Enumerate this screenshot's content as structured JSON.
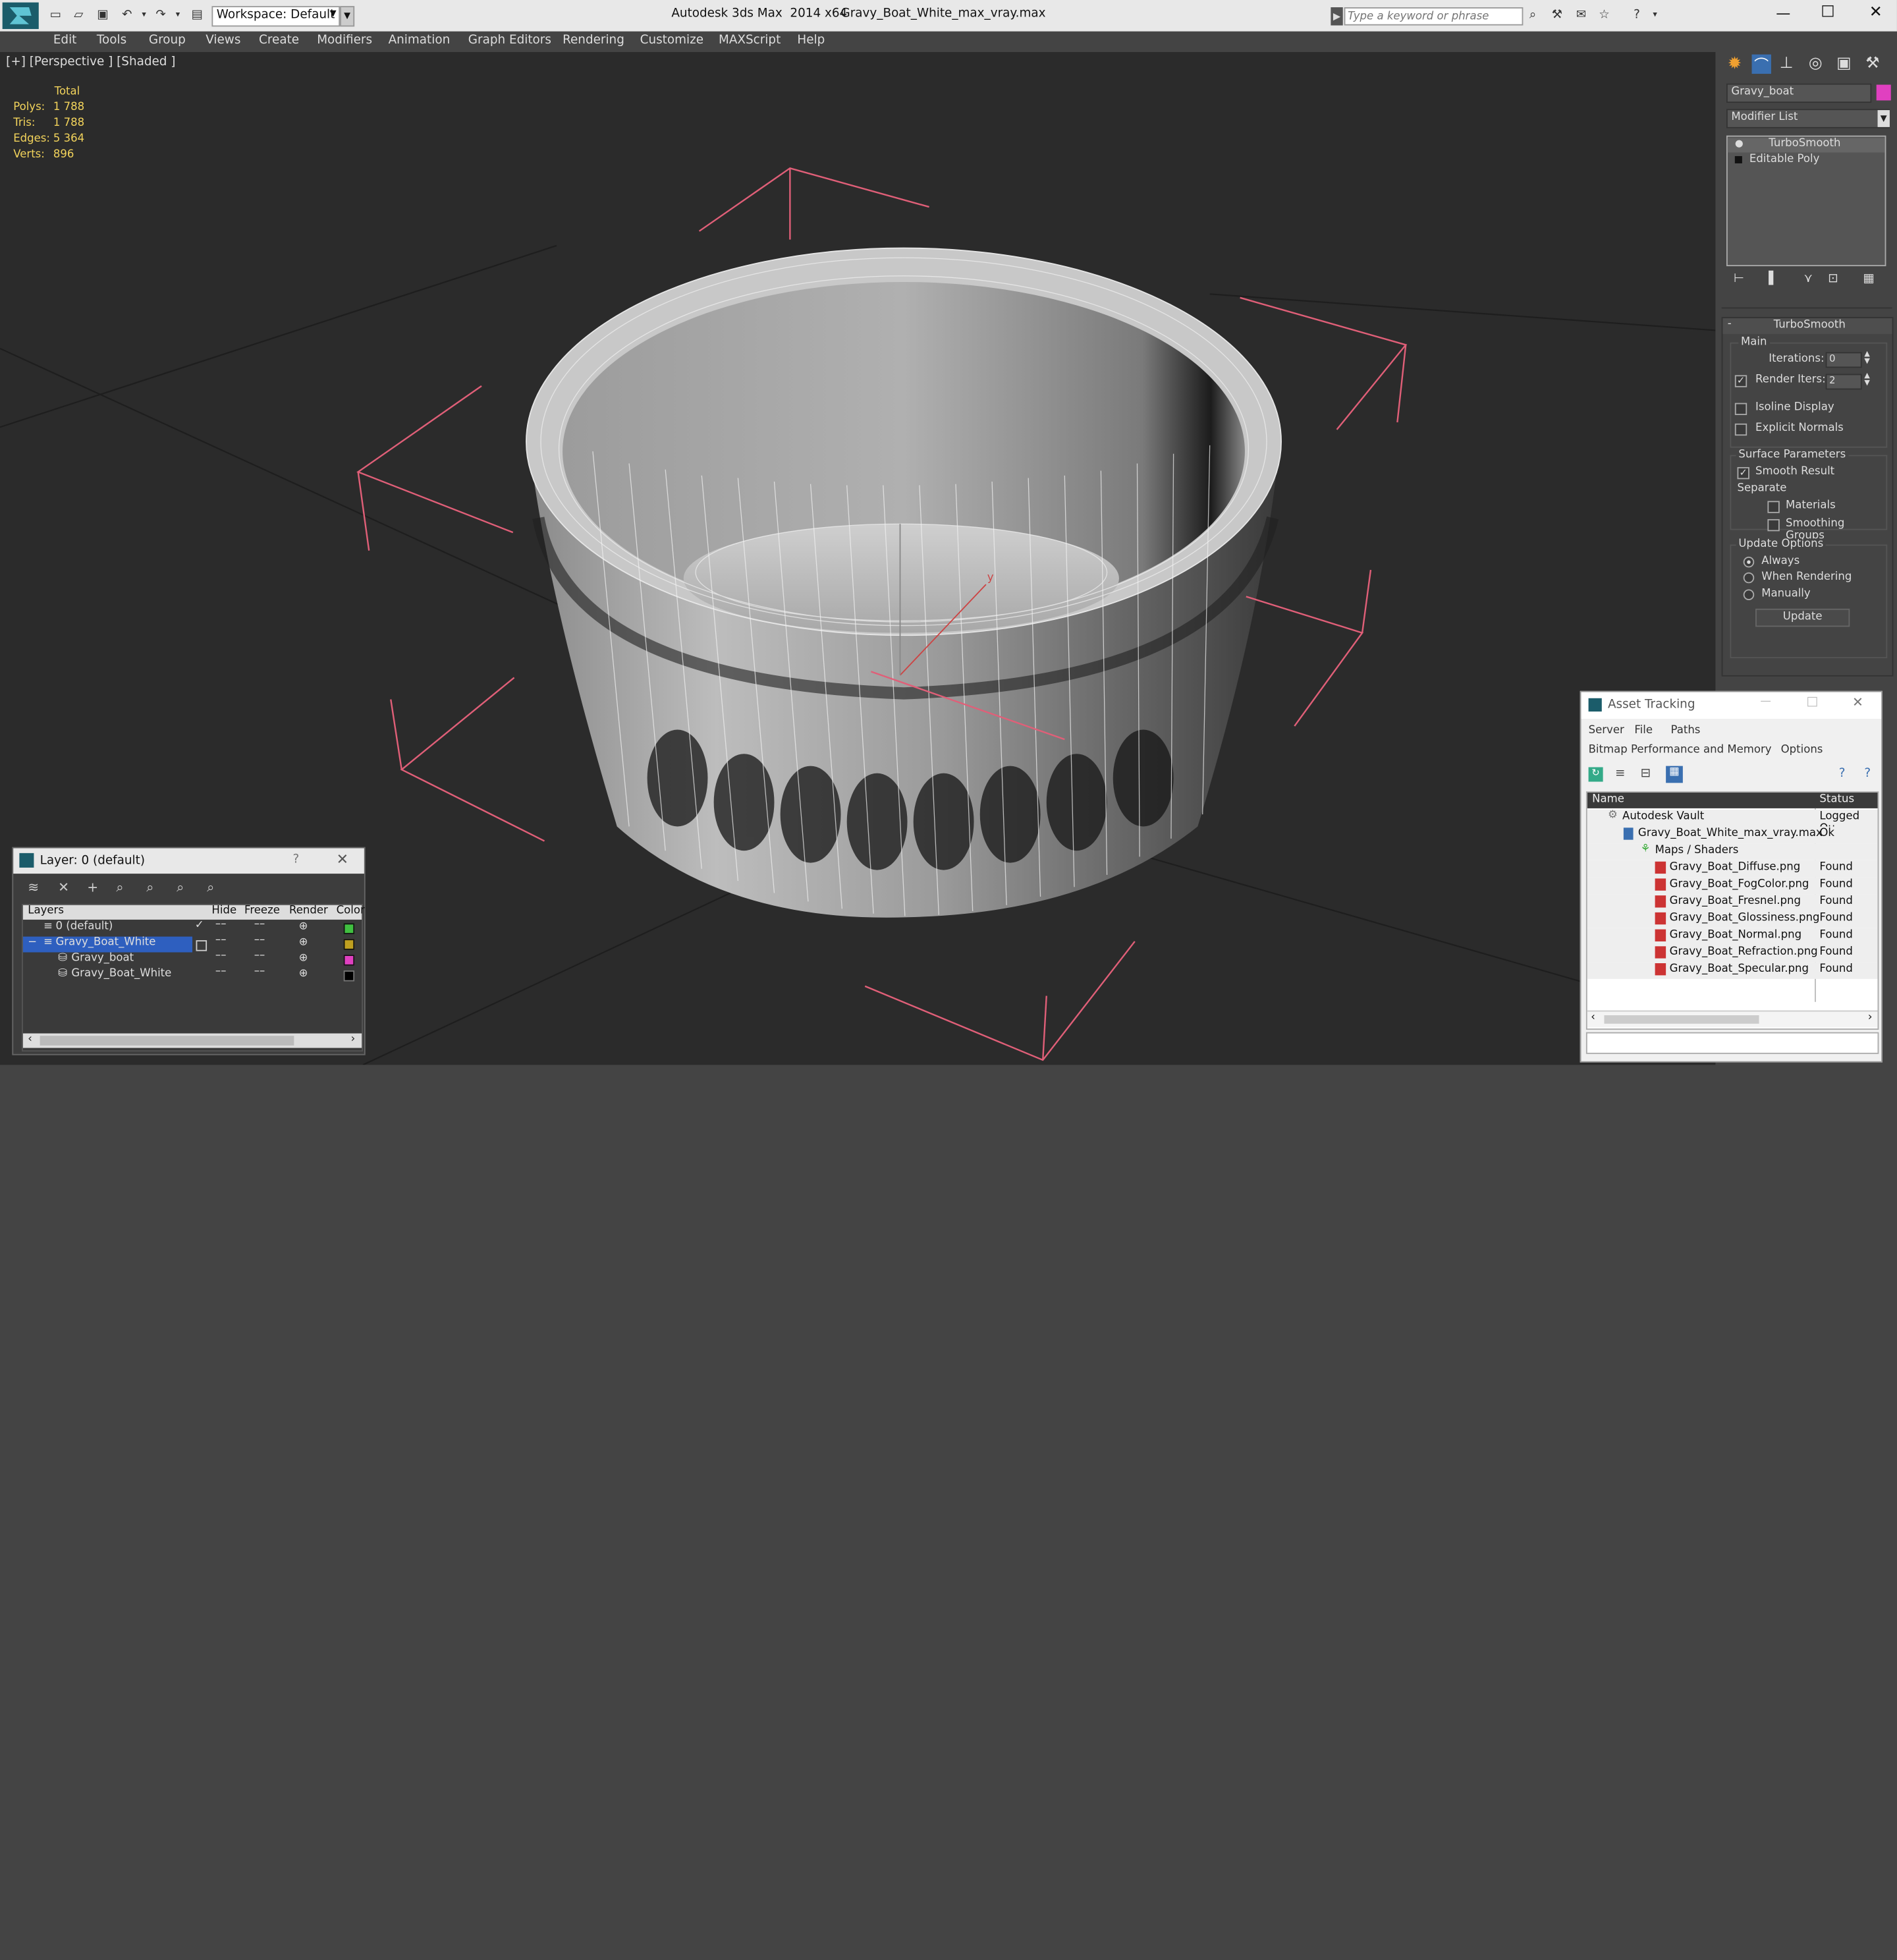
{
  "titlebar": {
    "app_title": "Autodesk 3ds Max  2014 x64",
    "file_title": "Gravy_Boat_White_max_vray.max",
    "workspace_label": "Workspace: Default",
    "search_placeholder": "Type a keyword or phrase"
  },
  "menu": [
    "Edit",
    "Tools",
    "Group",
    "Views",
    "Create",
    "Modifiers",
    "Animation",
    "Graph Editors",
    "Rendering",
    "Customize",
    "MAXScript",
    "Help"
  ],
  "viewport": {
    "label": "[+] [Perspective ] [Shaded ]",
    "stats": {
      "total_label": "Total",
      "polys_label": "Polys:",
      "polys": "1 788",
      "tris_label": "Tris:",
      "tris": "1 788",
      "edges_label": "Edges:",
      "edges": "5 364",
      "verts_label": "Verts:",
      "verts": "896"
    },
    "axis_y_label": "y"
  },
  "command_panel": {
    "object_name": "Gravy_boat",
    "object_color": "#e040c0",
    "modifier_list_label": "Modifier List",
    "stack": [
      "TurboSmooth",
      "Editable Poly"
    ],
    "rollout_title": "TurboSmooth",
    "main_label": "Main",
    "iterations_label": "Iterations:",
    "iterations_value": "0",
    "render_iters_label": "Render Iters:",
    "render_iters_value": "2",
    "isoline_label": "Isoline Display",
    "explicit_normals_label": "Explicit Normals",
    "surface_params_label": "Surface Parameters",
    "smooth_result_label": "Smooth Result",
    "separate_label": "Separate",
    "materials_label": "Materials",
    "smoothing_groups_label": "Smoothing Groups",
    "update_options_label": "Update Options",
    "always_label": "Always",
    "when_rendering_label": "When Rendering",
    "manually_label": "Manually",
    "update_button": "Update"
  },
  "layer_panel": {
    "title": "Layer: 0 (default)",
    "help": "?",
    "columns": {
      "layers": "Layers",
      "hide": "Hide",
      "freeze": "Freeze",
      "render": "Render",
      "color": "Color"
    },
    "rows": [
      {
        "name": "0 (default)",
        "color": "#40c040"
      },
      {
        "name": "Gravy_Boat_White",
        "color": "#c0a020"
      },
      {
        "name": "Gravy_boat",
        "color": "#e040c0"
      },
      {
        "name": "Gravy_Boat_White",
        "color": "#000000"
      }
    ]
  },
  "asset_tracking": {
    "title": "Asset Tracking",
    "menu": [
      "Server",
      "File",
      "Paths"
    ],
    "menu2": [
      "Bitmap Performance and Memory",
      "Options"
    ],
    "col_name": "Name",
    "col_status": "Status",
    "rows": [
      {
        "name": "Autodesk Vault",
        "status": "Logged Ou"
      },
      {
        "name": "Gravy_Boat_White_max_vray.max",
        "status": "Ok"
      },
      {
        "name": "Maps / Shaders",
        "status": ""
      },
      {
        "name": "Gravy_Boat_Diffuse.png",
        "status": "Found"
      },
      {
        "name": "Gravy_Boat_FogColor.png",
        "status": "Found"
      },
      {
        "name": "Gravy_Boat_Fresnel.png",
        "status": "Found"
      },
      {
        "name": "Gravy_Boat_Glossiness.png",
        "status": "Found"
      },
      {
        "name": "Gravy_Boat_Normal.png",
        "status": "Found"
      },
      {
        "name": "Gravy_Boat_Refraction.png",
        "status": "Found"
      },
      {
        "name": "Gravy_Boat_Specular.png",
        "status": "Found"
      }
    ]
  }
}
